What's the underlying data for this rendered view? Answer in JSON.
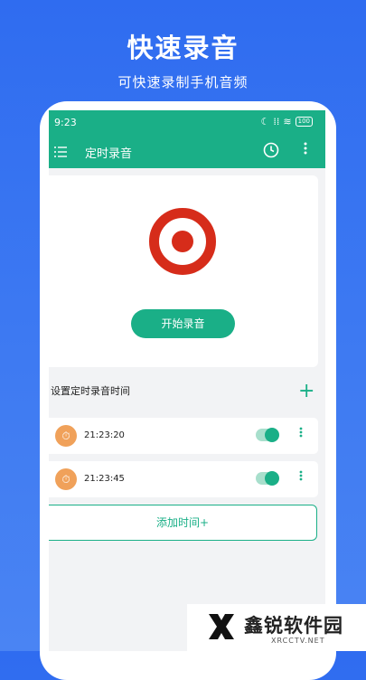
{
  "promo": {
    "title": "快速录音",
    "subtitle": "可快速录制手机音频"
  },
  "statusbar": {
    "time": "9:23",
    "battery": "100"
  },
  "appbar": {
    "title": "定时录音",
    "icons": [
      "menu-icon",
      "clock-icon",
      "more-vertical-icon"
    ]
  },
  "recorder": {
    "start_label": "开始录音",
    "accent": "#d62c1a"
  },
  "schedule": {
    "section_label": "设置定时录音时间",
    "add_plus": "+",
    "items": [
      {
        "time": "21:23:20",
        "enabled": true
      },
      {
        "time": "21:23:45",
        "enabled": true
      }
    ],
    "add_label": "添加时间+"
  },
  "watermark": {
    "text": "鑫锐软件园",
    "url": "XRCCTV.NET"
  },
  "colors": {
    "brand": "#1aaf87",
    "background": "#2f6cf0",
    "timer_icon": "#f0a15a"
  }
}
